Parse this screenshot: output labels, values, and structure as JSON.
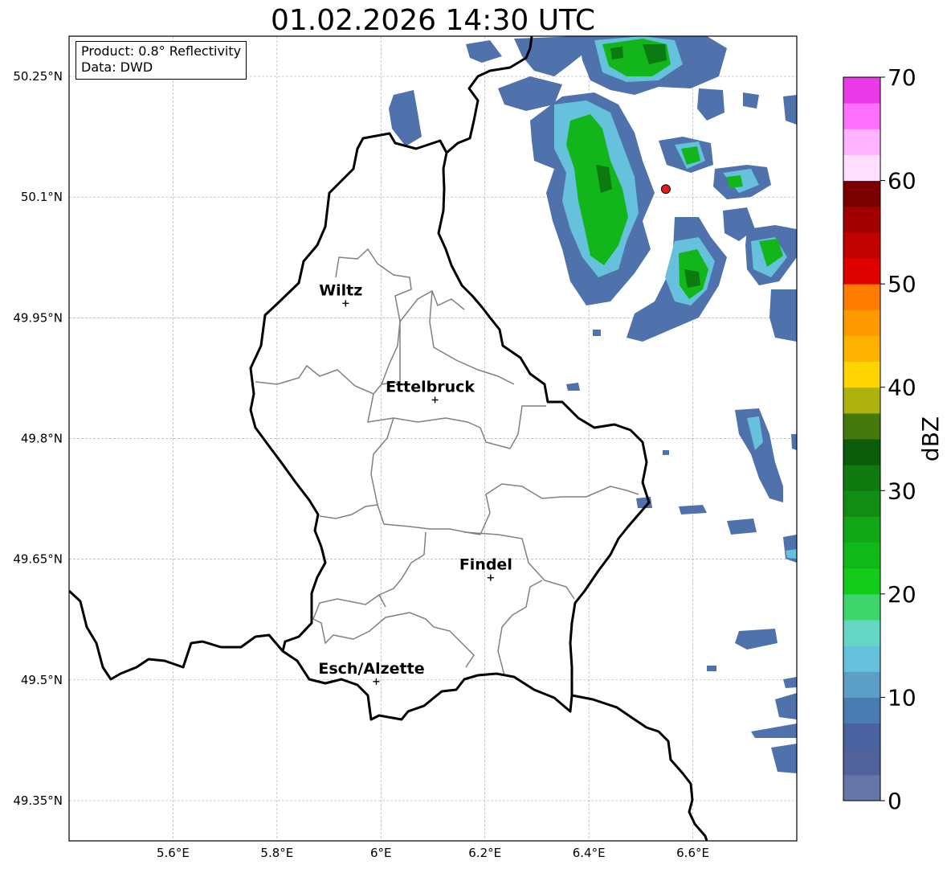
{
  "map": {
    "title": "01.02.2026 14:30 UTC",
    "info_box": {
      "product_line": "Product: 0.8° Reflectivity",
      "data_line": "Data: DWD"
    },
    "extent": {
      "lon_min": 5.4,
      "lon_max": 6.8,
      "lat_min": 49.3,
      "lat_max": 50.3
    },
    "x_ticks": [
      {
        "lon": 5.6,
        "label": "5.6°E"
      },
      {
        "lon": 5.8,
        "label": "5.8°E"
      },
      {
        "lon": 6.0,
        "label": "6°E"
      },
      {
        "lon": 6.2,
        "label": "6.2°E"
      },
      {
        "lon": 6.4,
        "label": "6.4°E"
      },
      {
        "lon": 6.6,
        "label": "6.6°E"
      }
    ],
    "y_ticks": [
      {
        "lat": 50.25,
        "label": "50.25°N"
      },
      {
        "lat": 50.1,
        "label": "50.1°N"
      },
      {
        "lat": 49.95,
        "label": "49.95°N"
      },
      {
        "lat": 49.8,
        "label": "49.8°N"
      },
      {
        "lat": 49.65,
        "label": "49.65°N"
      },
      {
        "lat": 49.5,
        "label": "49.5°N"
      },
      {
        "lat": 49.35,
        "label": "49.35°N"
      }
    ],
    "gridlines": true,
    "cities": [
      {
        "name": "Wiltz",
        "lon": 5.932,
        "lat": 49.968
      },
      {
        "name": "Ettelbruck",
        "lon": 6.104,
        "lat": 49.848
      },
      {
        "name": "Findel",
        "lon": 6.211,
        "lat": 49.627
      },
      {
        "name": "Esch/Alzette",
        "lon": 5.991,
        "lat": 49.498
      }
    ],
    "radar_site": {
      "lon": 6.548,
      "lat": 50.11,
      "color": "#e31a1c"
    },
    "colorbar": {
      "label": "dBZ",
      "min": 0,
      "max": 70,
      "step": 2.5,
      "ticks": [
        {
          "value": 0,
          "label": "0"
        },
        {
          "value": 10,
          "label": "10"
        },
        {
          "value": 20,
          "label": "20"
        },
        {
          "value": 30,
          "label": "30"
        },
        {
          "value": 40,
          "label": "40"
        },
        {
          "value": 50,
          "label": "50"
        },
        {
          "value": 60,
          "label": "60"
        },
        {
          "value": 70,
          "label": "70"
        }
      ],
      "colors": [
        "#6675a8",
        "#51619c",
        "#4863a0",
        "#4a7bb2",
        "#5b9fc6",
        "#66c1dc",
        "#64d7c4",
        "#3ed66c",
        "#12cb1b",
        "#11b81a",
        "#12a716",
        "#128d13",
        "#0e7a10",
        "#0a5c0b",
        "#46790c",
        "#adb20c",
        "#ffd400",
        "#ffb300",
        "#ff9900",
        "#ff7a00",
        "#e00000",
        "#c10000",
        "#a20000",
        "#7a0000",
        "#ffe1ff",
        "#ffb3ff",
        "#ff70ff",
        "#ea3ae8"
      ]
    }
  }
}
